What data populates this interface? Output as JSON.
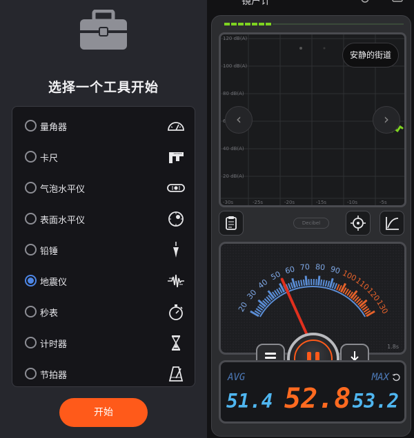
{
  "left": {
    "title": "选择一个工具开始",
    "start_label": "开始",
    "tools": [
      {
        "label": "量角器",
        "icon": "protractor-icon",
        "checked": false
      },
      {
        "label": "卡尺",
        "icon": "caliper-icon",
        "checked": false
      },
      {
        "label": "气泡水平仪",
        "icon": "bubble-level-icon",
        "checked": false
      },
      {
        "label": "表面水平仪",
        "icon": "surface-level-icon",
        "checked": false
      },
      {
        "label": "铅锤",
        "icon": "plumb-bob-icon",
        "checked": false
      },
      {
        "label": "地震仪",
        "icon": "seismograph-icon",
        "checked": true
      },
      {
        "label": "秒表",
        "icon": "stopwatch-icon",
        "checked": false
      },
      {
        "label": "计时器",
        "icon": "hourglass-icon",
        "checked": false
      },
      {
        "label": "节拍器",
        "icon": "metronome-icon",
        "checked": false
      }
    ],
    "accent": "#ff5a1a",
    "radio_color": "#4d86e6"
  },
  "right": {
    "status_time": "镜户计",
    "graph": {
      "location_badge": "安静的街道",
      "y_labels": [
        "120 dB(A)",
        "100 dB(A)",
        "80 dB(A)",
        "60",
        "40 dB(A)",
        "20 dB(A)"
      ],
      "x_labels": [
        "-30s",
        "-25s",
        "-20s",
        "-15s",
        "-10s",
        "-5s"
      ]
    },
    "brand": "Decibel",
    "meter": {
      "scale_labels": [
        "20",
        "30",
        "40",
        "50",
        "60",
        "70",
        "80",
        "90",
        "100",
        "110",
        "120",
        "130"
      ],
      "needle_value": 52.8,
      "time_label": "1.8s"
    },
    "readout": {
      "avg_label": "AVG",
      "max_label": "MAX",
      "avg_value": "51.4",
      "current_value": "52.8",
      "max_value": "53.2"
    },
    "colors": {
      "blue": "#4fb6f0",
      "orange": "#ff6a20",
      "green": "#7ed321"
    }
  }
}
